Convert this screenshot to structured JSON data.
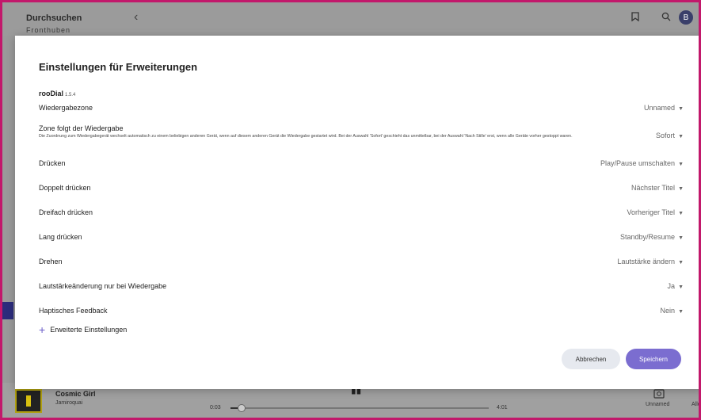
{
  "background": {
    "title": "Durchsuchen",
    "subtitle": "Fronthuben",
    "avatar_letter": "B"
  },
  "player": {
    "song": "Cosmic Girl",
    "artist": "Jamiroquai",
    "elapsed": "0:03",
    "total": "4:01",
    "progress": 0.04,
    "zone_label": "Unnamed",
    "all_label": "Alle"
  },
  "modal": {
    "title": "Einstellungen für Erweiterungen",
    "extension_name": "rooDial",
    "extension_version": "1.5.4",
    "rows": [
      {
        "label": "Wiedergabezone",
        "value": "Unnamed"
      },
      {
        "label": "Zone folgt der Wiedergabe",
        "value": "Sofort",
        "description": "Die Zuordnung zum Wiedergabegerät wechselt automatisch zu einem beliebigen anderen Gerät, wenn auf diesem anderen Gerät die Wiedergabe gestartet wird. Bei der Auswahl 'Sofort' geschieht das unmittelbar, bei der Auswahl 'Nach Stille' erst, wenn alle Geräte vorher gestoppt waren."
      },
      {
        "label": "Drücken",
        "value": "Play/Pause umschalten"
      },
      {
        "label": "Doppelt drücken",
        "value": "Nächster Titel"
      },
      {
        "label": "Dreifach drücken",
        "value": "Vorheriger Titel"
      },
      {
        "label": "Lang drücken",
        "value": "Standby/Resume"
      },
      {
        "label": "Drehen",
        "value": "Lautstärke ändern"
      },
      {
        "label": "Lautstärkeänderung nur bei Wiedergabe",
        "value": "Ja"
      },
      {
        "label": "Haptisches Feedback",
        "value": "Nein"
      }
    ],
    "advanced_label": "Erweiterte Einstellungen",
    "cancel_label": "Abbrechen",
    "save_label": "Speichern"
  },
  "colors": {
    "accent": "#7b6dd0",
    "frame_border": "#c2186b"
  },
  "icons": {
    "back": "chevron-left-icon",
    "bookmark": "bookmark-icon",
    "search": "search-icon",
    "caret": "caret-down-icon",
    "plus": "plus-icon"
  }
}
